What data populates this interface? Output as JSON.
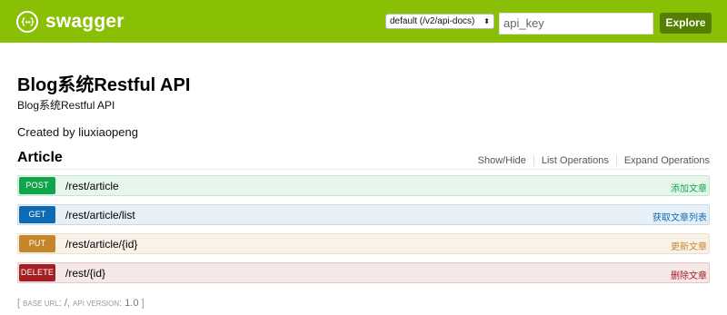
{
  "header": {
    "logo_icon": "{↔}",
    "logo_text": "swagger",
    "api_select_value": "default (/v2/api-docs)",
    "api_select_caret": "⬍",
    "api_key_placeholder": "api_key",
    "explore_label": "Explore",
    "bar_color": "#89bf04"
  },
  "info": {
    "title": "Blog系统Restful API",
    "description": "Blog系统Restful API",
    "created_by": "Created by liuxiaopeng"
  },
  "resource": {
    "name": "Article",
    "links": [
      "Show/Hide",
      "List Operations",
      "Expand Operations"
    ],
    "operations": [
      {
        "method": "POST",
        "path": "/rest/article",
        "summary": "添加文章",
        "color": "#10a54a"
      },
      {
        "method": "GET",
        "path": "/rest/article/list",
        "summary": "获取文章列表",
        "color": "#0f6ab4"
      },
      {
        "method": "PUT",
        "path": "/rest/article/{id}",
        "summary": "更新文章",
        "color": "#c5862b"
      },
      {
        "method": "DELETE",
        "path": "/rest/{id}",
        "summary": "删除文章",
        "color": "#a41e22"
      }
    ]
  },
  "footer": {
    "open": "[",
    "base_url_label": "BASE URL",
    "base_url_value": "/",
    "api_version_label": "API VERSION",
    "api_version_value": "1.0",
    "close": "]"
  }
}
